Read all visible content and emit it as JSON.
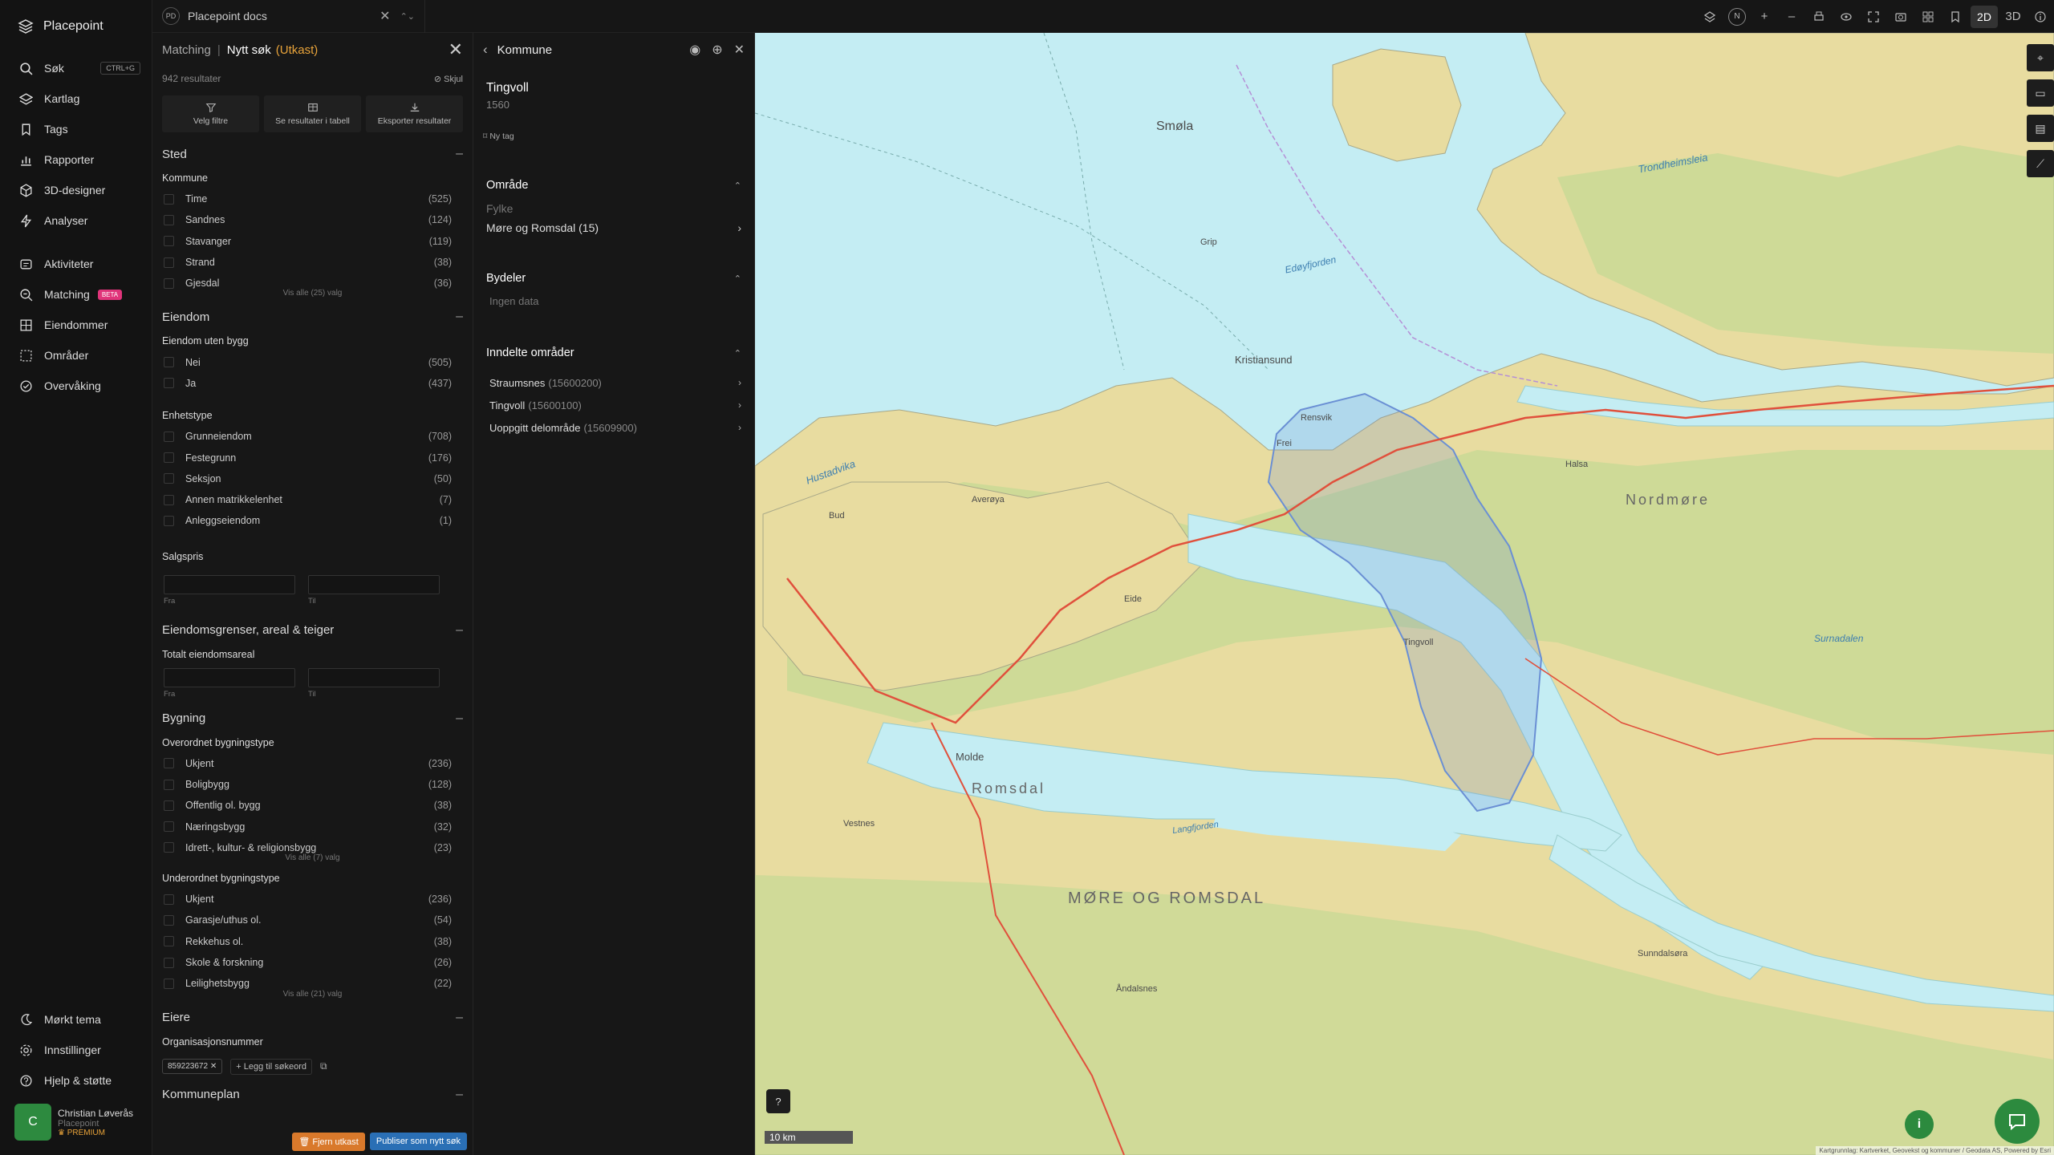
{
  "app": {
    "name": "Placepoint"
  },
  "tab": {
    "badge": "PD",
    "title": "Placepoint docs"
  },
  "toolbar": {
    "north": "N",
    "plus": "+",
    "minus": "–",
    "mode2d": "2D",
    "mode3d": "3D"
  },
  "nav": {
    "items": [
      {
        "label": "Søk",
        "icon": "search-icon",
        "kbd": "CTRL+G"
      },
      {
        "label": "Kartlag",
        "icon": "layers-icon"
      },
      {
        "label": "Tags",
        "icon": "bookmark-icon"
      },
      {
        "label": "Rapporter",
        "icon": "chart-icon"
      },
      {
        "label": "3D-designer",
        "icon": "cube-icon"
      },
      {
        "label": "Analyser",
        "icon": "bolt-icon"
      }
    ],
    "items2": [
      {
        "label": "Aktiviteter",
        "icon": "activity-icon"
      },
      {
        "label": "Matching",
        "icon": "matching-icon",
        "badge": "BETA"
      },
      {
        "label": "Eiendommer",
        "icon": "property-icon"
      },
      {
        "label": "Områder",
        "icon": "area-icon"
      },
      {
        "label": "Overvåking",
        "icon": "monitor-icon"
      }
    ],
    "bottom": [
      {
        "label": "Mørkt tema",
        "icon": "moon-icon"
      },
      {
        "label": "Innstillinger",
        "icon": "gear-icon"
      },
      {
        "label": "Hjelp & støtte",
        "icon": "help-icon"
      }
    ],
    "user": {
      "initial": "C",
      "name": "Christian Løverås",
      "org": "Placepoint",
      "plan": "PREMIUM"
    }
  },
  "search": {
    "breadcrumb": "Matching",
    "title": "Nytt søk",
    "status": "(Utkast)",
    "results": "942 resultater",
    "hide": "Skjul",
    "actions": [
      "Velg filtre",
      "Se resultater i tabell",
      "Eksporter resultater"
    ],
    "sted": {
      "title": "Sted",
      "kommune_label": "Kommune",
      "kommune": [
        {
          "name": "Time",
          "count": "(525)"
        },
        {
          "name": "Sandnes",
          "count": "(124)"
        },
        {
          "name": "Stavanger",
          "count": "(119)"
        },
        {
          "name": "Strand",
          "count": "(38)"
        },
        {
          "name": "Gjesdal",
          "count": "(36)"
        }
      ],
      "more": "Vis alle (25) valg"
    },
    "eiendom": {
      "title": "Eiendom",
      "uten_bygg_label": "Eiendom uten bygg",
      "uten_bygg": [
        {
          "name": "Nei",
          "count": "(505)"
        },
        {
          "name": "Ja",
          "count": "(437)"
        }
      ],
      "enhetstype_label": "Enhetstype",
      "enhetstype": [
        {
          "name": "Grunneiendom",
          "count": "(708)"
        },
        {
          "name": "Festegrunn",
          "count": "(176)"
        },
        {
          "name": "Seksjon",
          "count": "(50)"
        },
        {
          "name": "Annen matrikkelenhet",
          "count": "(7)"
        },
        {
          "name": "Anleggseiendom",
          "count": "(1)"
        }
      ],
      "salgspris_label": "Salgspris",
      "from": "Fra",
      "to": "Til"
    },
    "grenser": {
      "title": "Eiendomsgrenser, areal & teiger",
      "areal_label": "Totalt eiendomsareal",
      "from": "Fra",
      "to": "Til"
    },
    "bygning": {
      "title": "Bygning",
      "over_label": "Overordnet bygningstype",
      "over": [
        {
          "name": "Ukjent",
          "count": "(236)"
        },
        {
          "name": "Boligbygg",
          "count": "(128)"
        },
        {
          "name": "Offentlig ol. bygg",
          "count": "(38)"
        },
        {
          "name": "Næringsbygg",
          "count": "(32)"
        },
        {
          "name": "Idrett-, kultur- & religionsbygg",
          "count": "(23)"
        }
      ],
      "over_more": "Vis alle (7) valg",
      "under_label": "Underordnet bygningstype",
      "under": [
        {
          "name": "Ukjent",
          "count": "(236)"
        },
        {
          "name": "Garasje/uthus ol.",
          "count": "(54)"
        },
        {
          "name": "Rekkehus ol.",
          "count": "(38)"
        },
        {
          "name": "Skole & forskning",
          "count": "(26)"
        },
        {
          "name": "Leilighetsbygg",
          "count": "(22)"
        }
      ],
      "under_more": "Vis alle (21) valg"
    },
    "eiere": {
      "title": "Eiere",
      "org_label": "Organisasjonsnummer",
      "chip": "859223672",
      "add": "Legg til søkeord"
    },
    "kommuneplan": {
      "title": "Kommuneplan"
    },
    "footer": {
      "remove": "Fjern utkast",
      "publish": "Publiser som nytt søk"
    }
  },
  "detail": {
    "title": "Kommune",
    "name": "Tingvoll",
    "number": "1560",
    "tag": "Ny tag",
    "omrade": {
      "title": "Område",
      "fylke_label": "Fylke",
      "fylke": "Møre og Romsdal (15)"
    },
    "bydeler": {
      "title": "Bydeler",
      "empty": "Ingen data"
    },
    "inndelte": {
      "title": "Inndelte områder",
      "items": [
        {
          "name": "Straumsnes",
          "code": "(15600200)"
        },
        {
          "name": "Tingvoll",
          "code": "(15600100)"
        },
        {
          "name": "Uoppgitt delområde",
          "code": "(15609900)"
        }
      ]
    }
  },
  "map": {
    "labels": {
      "smola": "Smøla",
      "kristiansund": "Kristiansund",
      "molde": "Molde",
      "romsdal": "Romsdal",
      "more": "MØRE OG ROMSDAL",
      "nordmore": "Nordmøre",
      "tingvoll": "Tingvoll",
      "hustadvika": "Hustadvika",
      "edoyfjorden": "Edøyfjorden",
      "trondheimsleia": "Trondheimsleia",
      "langfjorden": "Langfjorden",
      "surnadalen": "Surnadalen",
      "andalsnes": "Åndalsnes",
      "grip": "Grip",
      "averoya": "Averøya",
      "halsa": "Halsa",
      "sunndalsora": "Sunndalsøra",
      "eide": "Eide",
      "bud": "Bud",
      "vestnes": "Vestnes",
      "frei": "Frei",
      "rensvik": "Rensvik"
    },
    "scale": "10 km",
    "attribution": "Kartgrunnlag: Kartverket, Geovekst og kommuner / Geodata AS, Powered by Esri",
    "colors": {
      "water": "#c4edf3",
      "land": "#e8dca0",
      "forest": "#b8d890",
      "border": "#6a8fd4",
      "road": "#e0503c"
    }
  }
}
